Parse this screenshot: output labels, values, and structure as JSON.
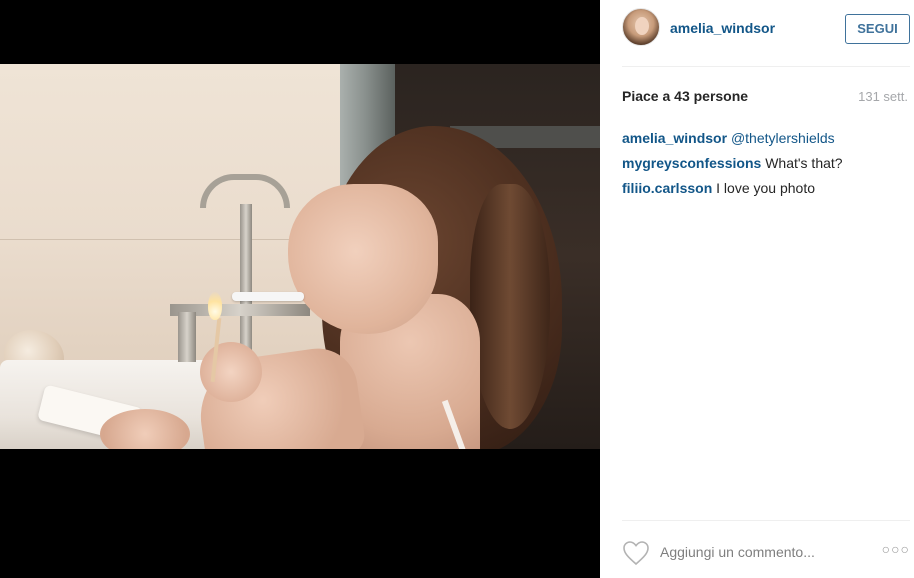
{
  "post": {
    "image_alt": "Young woman in a bathroom lighting a match with a toothbrush in her mouth",
    "likes_text": "Piace a 43 persone",
    "age_text": "131 sett."
  },
  "author": {
    "username": "amelia_windsor",
    "follow_label": "SEGUI"
  },
  "comments": [
    {
      "user": "amelia_windsor",
      "text": "",
      "mention": "@thetylershields"
    },
    {
      "user": "mygreysconfessions",
      "text": "What's that?",
      "mention": ""
    },
    {
      "user": "filiio.carlsson",
      "text": "I love you photo",
      "mention": ""
    }
  ],
  "footer": {
    "comment_placeholder": "Aggiungi un commento...",
    "more_label": "○○○",
    "like_icon": "heart-icon"
  },
  "colors": {
    "link": "#125688",
    "follow_border": "#3f729b",
    "muted": "#a5a7aa"
  }
}
